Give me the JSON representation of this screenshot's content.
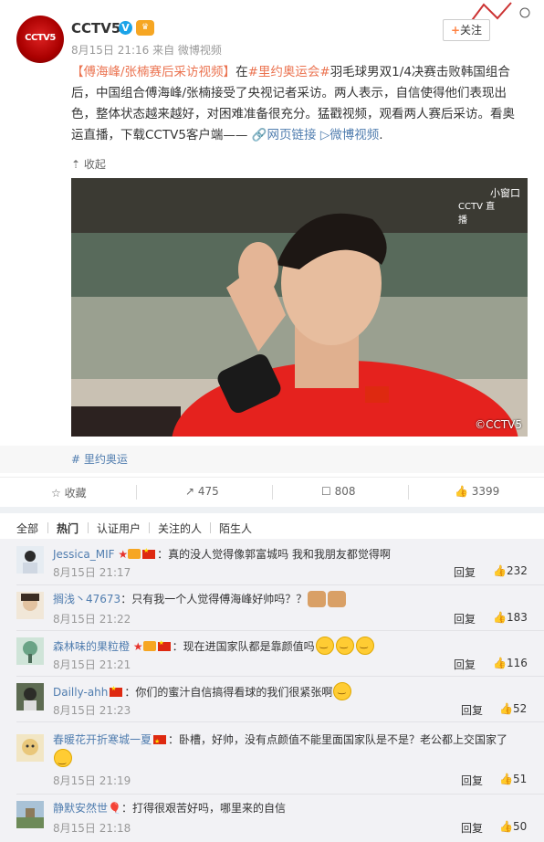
{
  "post": {
    "poster_name": "CCTV5",
    "avatar_text": "CCTV5",
    "meta": "8月15日 21:16 来自 微博视频",
    "follow_label": "关注",
    "body_parts": {
      "title": "【傅海峰/张楠赛后采访视频】",
      "p1": "在",
      "topic1": "#里约奥运会#",
      "p2": "羽毛球男双1/4决赛击败韩国组合后，中国组合傅海峰/张楠接受了央视记者采访。两人表示，自信使得他们表现出色，整体状态越来越好，对困难准备很充分。猛戳视频，观看两人赛后采访。看奥运直播，下载CCTV5客户端——",
      "link1": "网页链接",
      "link2": "微博视频",
      "p3": "."
    },
    "collapse_label": "收起",
    "photo": {
      "mini_window": "小窗口",
      "channel_logo": "CCTV 直播",
      "watermark": "©CCTV5"
    },
    "topic_tag": "里约奥运",
    "actions": {
      "favorite": "收藏",
      "repost": "475",
      "comment": "808",
      "like": "3399"
    }
  },
  "filters": [
    "全部",
    "热门",
    "认证用户",
    "关注的人",
    "陌生人"
  ],
  "comments": [
    {
      "user": "Jessica_MIF",
      "text": "：真的没人觉得像郭富城吗 我和我朋友都觉得啊",
      "time": "8月15日 21:17",
      "reply": "回复",
      "likes": "232"
    },
    {
      "user": "搁浅丶47673",
      "text": "：只有我一个人觉得傅海峰好帅吗？？",
      "time": "8月15日 21:22",
      "reply": "回复",
      "likes": "183"
    },
    {
      "user": "森林味的果粒橙",
      "text": "：现在进国家队都是靠颜值吗",
      "time": "8月15日 21:21",
      "reply": "回复",
      "likes": "116"
    },
    {
      "user": "Dailly-ahh",
      "text": "：你们的蜜汁自信搞得看球的我们很紧张啊",
      "time": "8月15日 21:23",
      "reply": "回复",
      "likes": "52"
    },
    {
      "user": "春暖花开折寒城一夏",
      "text": "：卧槽，好帅，没有点颜值不能里面国家队是不是？老公都上交国家了",
      "time": "8月15日 21:19",
      "reply": "回复",
      "likes": "51"
    },
    {
      "user": "静默安然世",
      "text": "：打得很艰苦好吗，哪里来的自信",
      "time": "8月15日 21:18",
      "reply": "回复",
      "likes": "50"
    }
  ],
  "colors": {
    "accent": "#eb7350",
    "link": "#507daf",
    "brand": "#d22"
  }
}
